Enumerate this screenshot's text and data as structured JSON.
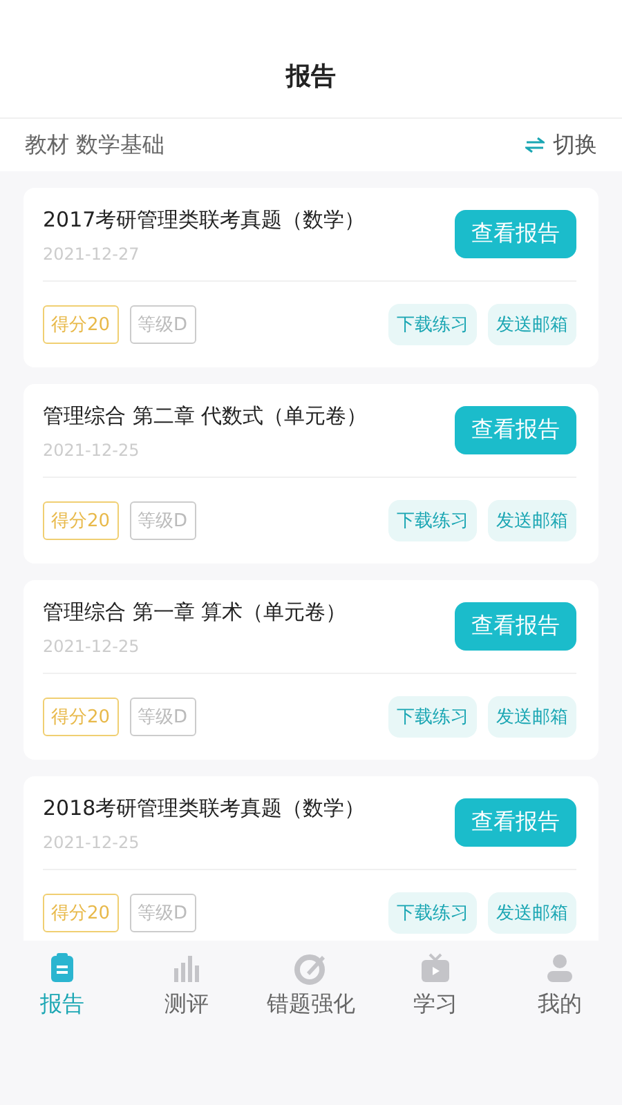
{
  "header": {
    "title": "报告"
  },
  "subheader": {
    "label": "教材 数学基础",
    "switch": "切换"
  },
  "reports": [
    {
      "title": "2017考研管理类联考真题（数学）",
      "date": "2021-12-27",
      "view": "查看报告",
      "score": "得分20",
      "grade": "等级D",
      "download": "下载练习",
      "email": "发送邮箱"
    },
    {
      "title": "管理综合  第二章 代数式（单元卷）",
      "date": "2021-12-25",
      "view": "查看报告",
      "score": "得分20",
      "grade": "等级D",
      "download": "下载练习",
      "email": "发送邮箱"
    },
    {
      "title": "管理综合  第一章 算术（单元卷）",
      "date": "2021-12-25",
      "view": "查看报告",
      "score": "得分20",
      "grade": "等级D",
      "download": "下载练习",
      "email": "发送邮箱"
    },
    {
      "title": "2018考研管理类联考真题（数学）",
      "date": "2021-12-25",
      "view": "查看报告",
      "score": "得分20",
      "grade": "等级D",
      "download": "下载练习",
      "email": "发送邮箱"
    }
  ],
  "tabs": [
    {
      "label": "报告",
      "kind": "clipboard",
      "selected": true
    },
    {
      "label": "测评",
      "kind": "bars",
      "selected": false
    },
    {
      "label": "错题强化",
      "kind": "pen",
      "selected": false
    },
    {
      "label": "学习",
      "kind": "tv",
      "selected": false
    },
    {
      "label": "我的",
      "kind": "person",
      "selected": false
    }
  ]
}
